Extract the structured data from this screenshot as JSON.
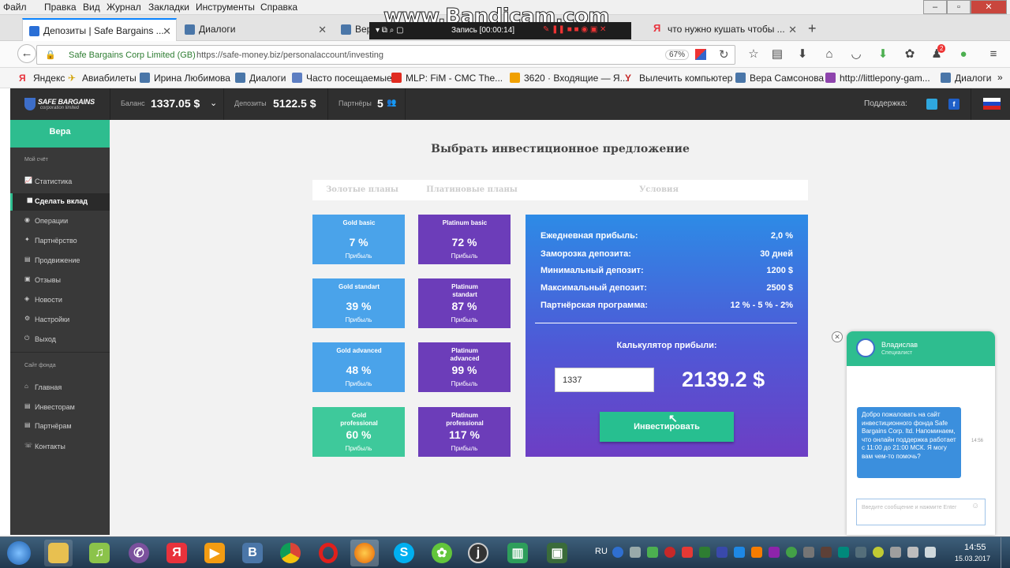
{
  "menu": [
    "Файл",
    "Правка",
    "Вид",
    "Журнал",
    "Закладки",
    "Инструменты",
    "Справка"
  ],
  "recording": {
    "brand": "www.Bandicam.com",
    "status": "Запись [00:00:14]"
  },
  "tabs": [
    {
      "label": "Депозиты | Safe Bargains ...",
      "active": true,
      "color": "#2a6fd6"
    },
    {
      "label": "Диалоги",
      "active": false,
      "color": "#4a76a8"
    },
    {
      "label": "Вер",
      "active": false,
      "color": "#4a76a8"
    },
    {
      "label": "что нужно кушать чтобы ...",
      "active": false,
      "color": "#e8323c"
    }
  ],
  "address": {
    "site_name": "Safe Bargains Corp Limited (GB)",
    "url": "https://safe-money.biz/personalaccount/investing",
    "zoom": "67%"
  },
  "bookmarks": [
    {
      "label": "Яндекс",
      "color": "#e8323c"
    },
    {
      "label": "Авиабилеты",
      "color": "#f0c419"
    },
    {
      "label": "Ирина Любимова",
      "color": "#4a76a8"
    },
    {
      "label": "Диалоги",
      "color": "#4a76a8"
    },
    {
      "label": "Часто посещаемые",
      "color": "#5d7ec2"
    },
    {
      "label": "MLP: FiM - CMC The...",
      "color": "#e02b20"
    },
    {
      "label": "3620 · Входящие — Я...",
      "color": "#f0a000"
    },
    {
      "label": "Вылечить компьютер",
      "color": "#c62828"
    },
    {
      "label": "Вера Самсонова",
      "color": "#4a76a8"
    },
    {
      "label": "http://littlepony-gam...",
      "color": "#8e44ad"
    },
    {
      "label": "Диалоги",
      "color": "#4a76a8"
    }
  ],
  "topbar": {
    "logo_line1": "SAFE BARGAINS",
    "logo_line2": "corporation limited",
    "balance_label": "Баланс",
    "balance_value": "1337.05 $",
    "deposits_label": "Депозиты",
    "deposits_value": "5122.5 $",
    "partners_label": "Партнёры",
    "partners_value": "5",
    "support_label": "Поддержка:"
  },
  "sidebar": {
    "user": "Вера",
    "section1": "Мой счёт",
    "items1": [
      {
        "label": "Статистика",
        "icon": "chart-icon"
      },
      {
        "label": "Сделать вклад",
        "icon": "deposit-icon",
        "active": true
      },
      {
        "label": "Операции",
        "icon": "operations-icon"
      },
      {
        "label": "Партнёрство",
        "icon": "partners-icon"
      },
      {
        "label": "Продвижение",
        "icon": "promo-icon"
      },
      {
        "label": "Отзывы",
        "icon": "reviews-icon"
      },
      {
        "label": "Новости",
        "icon": "news-icon"
      },
      {
        "label": "Настройки",
        "icon": "gear-icon"
      },
      {
        "label": "Выход",
        "icon": "power-icon"
      }
    ],
    "section2": "Сайт фонда",
    "items2": [
      {
        "label": "Главная",
        "icon": "home-icon"
      },
      {
        "label": "Инвесторам",
        "icon": "investors-icon"
      },
      {
        "label": "Партнёрам",
        "icon": "partner-icon"
      },
      {
        "label": "Контакты",
        "icon": "contacts-icon"
      }
    ]
  },
  "main": {
    "title": "Выбрать инвестиционное предложение",
    "headers": [
      "Золотые планы",
      "Платиновые планы",
      "Условия"
    ],
    "gold_plans": [
      {
        "name": "Gold basic",
        "percent": "7 %",
        "label": "Прибыль"
      },
      {
        "name": "Gold standart",
        "percent": "39 %",
        "label": "Прибыль"
      },
      {
        "name": "Gold advanced",
        "percent": "48 %",
        "label": "Прибыль"
      },
      {
        "name": "Gold professional",
        "percent": "60 %",
        "label": "Прибыль"
      }
    ],
    "platinum_plans": [
      {
        "name": "Platinum basic",
        "percent": "72 %",
        "label": "Прибыль"
      },
      {
        "name": "Platinum standart",
        "percent": "87 %",
        "label": "Прибыль"
      },
      {
        "name": "Platinum advanced",
        "percent": "99 %",
        "label": "Прибыль"
      },
      {
        "name": "Platinum professional",
        "percent": "117 %",
        "label": "Прибыль"
      }
    ],
    "terms": [
      {
        "label": "Ежедневная прибыль:",
        "value": "2,0 %"
      },
      {
        "label": "Заморозка депозита:",
        "value": "30 дней"
      },
      {
        "label": "Минимальный депозит:",
        "value": "1200 $"
      },
      {
        "label": "Максимальный депозит:",
        "value": "2500 $"
      },
      {
        "label": "Партнёрская программа:",
        "value": "12 % - 5 % - 2%"
      }
    ],
    "calc_label": "Калькулятор прибыли:",
    "calc_input": "1337",
    "calc_result": "2139.2 $",
    "invest_button": "Инвестировать"
  },
  "chat": {
    "agent_name": "Владислав",
    "agent_role": "Специалист",
    "message": "Добро пожаловать на сайт инвестиционного фонда Safe Bargains Corp. ltd. Напоминаем, что онлайн поддержка работает с 11:00 до 21:00 МСК. Я могу вам чем-то помочь?",
    "time": "14:56",
    "placeholder": "Введите сообщение и нажмите Enter"
  },
  "taskbar": {
    "lang": "RU",
    "time": "14:55",
    "date": "15.03.2017",
    "notif_count": "2"
  }
}
